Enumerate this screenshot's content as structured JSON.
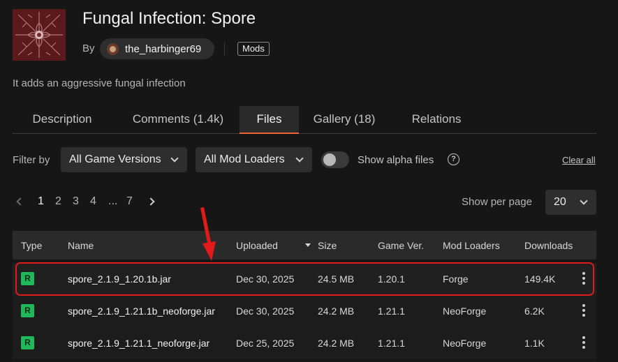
{
  "header": {
    "title": "Fungal Infection: Spore",
    "by_label": "By",
    "author": "the_harbinger69",
    "category_tag": "Mods",
    "summary": "It adds an aggressive fungal infection"
  },
  "tabs": [
    {
      "label": "Description",
      "active": false
    },
    {
      "label": "Comments (1.4k)",
      "active": false
    },
    {
      "label": "Files",
      "active": true
    },
    {
      "label": "Gallery (18)",
      "active": false
    },
    {
      "label": "Relations",
      "active": false
    }
  ],
  "filters": {
    "label": "Filter by",
    "game_versions": "All Game Versions",
    "mod_loaders": "All Mod Loaders",
    "show_alpha_label": "Show alpha files",
    "show_alpha_enabled": false,
    "clear_all": "Clear all"
  },
  "pagination": {
    "pages": [
      "1",
      "2",
      "3",
      "4",
      "...",
      "7"
    ],
    "current": "1",
    "show_per_page_label": "Show per page",
    "per_page": "20"
  },
  "table": {
    "columns": [
      "Type",
      "Name",
      "Uploaded",
      "Size",
      "Game Ver.",
      "Mod Loaders",
      "Downloads"
    ],
    "sorted_column": "Uploaded",
    "rows": [
      {
        "type": "R",
        "name": "spore_2.1.9_1.20.1b.jar",
        "uploaded": "Dec 30, 2025",
        "size": "24.5 MB",
        "game_ver": "1.20.1",
        "loader": "Forge",
        "downloads": "149.4K"
      },
      {
        "type": "R",
        "name": "spore_2.1.9_1.21.1b_neoforge.jar",
        "uploaded": "Dec 30, 2025",
        "size": "24.2 MB",
        "game_ver": "1.21.1",
        "loader": "NeoForge",
        "downloads": "6.2K"
      },
      {
        "type": "R",
        "name": "spore_2.1.9_1.21.1_neoforge.jar",
        "uploaded": "Dec 25, 2025",
        "size": "24.2 MB",
        "game_ver": "1.21.1",
        "loader": "NeoForge",
        "downloads": "1.1K"
      }
    ]
  },
  "colors": {
    "accent": "#f16436",
    "release_badge": "#1fb85a",
    "highlight": "#e31a1a"
  }
}
